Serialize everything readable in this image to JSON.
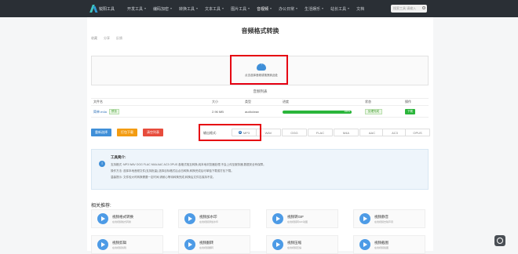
{
  "nav": {
    "logo_text": "锐阳工具",
    "items": [
      {
        "label": "开发工具"
      },
      {
        "label": "编码加密"
      },
      {
        "label": "转换工具"
      },
      {
        "label": "文本工具"
      },
      {
        "label": "图片工具"
      },
      {
        "label": "音视频"
      },
      {
        "label": "办公日常"
      },
      {
        "label": "生活娱乐"
      },
      {
        "label": "站长工具"
      },
      {
        "label": "文档"
      }
    ],
    "search_placeholder": "搜索工具 请输入"
  },
  "page": {
    "title": "音频格式转换",
    "meta": [
      "收藏",
      "分享",
      "反馈"
    ]
  },
  "upload": {
    "text": "点击选择音频或拖拽到此处"
  },
  "file_list": {
    "title": "音频列表",
    "columns": [
      "文件名",
      "大小",
      "类型",
      "进度",
      "状态",
      "操作"
    ],
    "rows": [
      {
        "name": "简单.m4a",
        "preview": "预览",
        "size": "2.96 MB",
        "type": "audio/wav",
        "progress": 100,
        "progress_text": "100%",
        "status": "处理完成",
        "action": "下载"
      }
    ]
  },
  "actions": {
    "select": "重新选择",
    "pack": "打包下载",
    "clear": "清空列表"
  },
  "format": {
    "label": "输出格式:",
    "options": [
      "MP3",
      "WAV",
      "OGG",
      "FLAC",
      "M4A",
      "AAC",
      "AC3",
      "OPUS"
    ],
    "selected": "MP3"
  },
  "intro": {
    "title": "工具简介:",
    "lines": [
      "支持格式:  MP3  WAV  OGG  FLAC  M4A  AAC  AC3  OPUS  各格式相互转换,纯本地浏览器处理,不会上传至服务器,数据安全有保障。",
      "操作方法: 选择本地音频文件(支持批量),选择目标格式后点击转换,转换完成后可单独下载或打包下载。",
      "温馨提示: 文件较大时转换需要一定时间,请耐心等待转换完成,转换后文件名保持不变。"
    ]
  },
  "recommend": {
    "title": "相关推荐:",
    "items": [
      {
        "name": "视频格式转换",
        "desc": "在线视频格式转换"
      },
      {
        "name": "视频加水印",
        "desc": "在线视频添加水印"
      },
      {
        "name": "视频转GIF",
        "desc": "在线视频转GIF动图"
      },
      {
        "name": "视频静音",
        "desc": "在线视频去除声音"
      },
      {
        "name": "视频剪辑",
        "desc": "在线视频剪辑"
      },
      {
        "name": "视频翻转",
        "desc": "在线视频翻转"
      },
      {
        "name": "视频压缩",
        "desc": "在线视频压缩"
      },
      {
        "name": "视频截图",
        "desc": "在线视频截图"
      }
    ]
  },
  "colors": {
    "nav_bg": "#2a2f35",
    "highlight": "#e60012",
    "primary": "#3f8fd8",
    "success": "#2ab53a",
    "warning": "#f39c12",
    "danger": "#e74c3c"
  }
}
